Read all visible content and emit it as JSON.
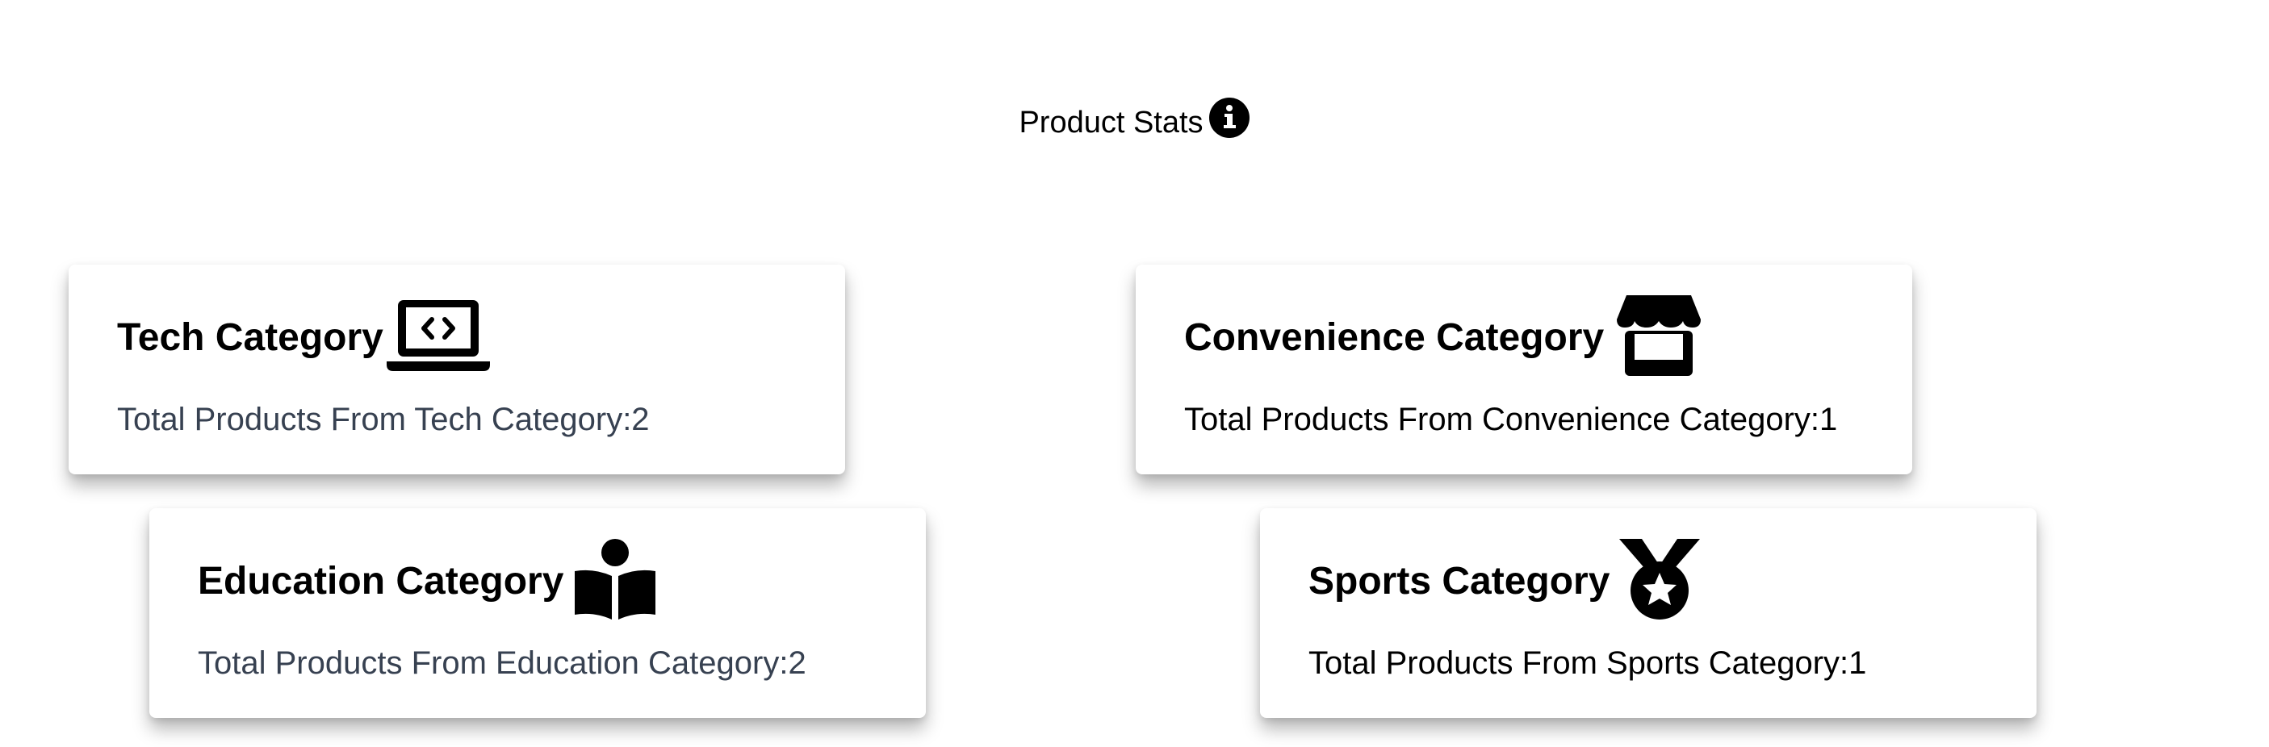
{
  "header": {
    "title": "Product Stats",
    "info_icon": "info-circle-icon"
  },
  "cards": [
    {
      "id": "tech",
      "title": "Tech Category",
      "icon": "laptop-code-icon",
      "description": "Total Products From Tech Category:2",
      "count": 2
    },
    {
      "id": "convenience",
      "title": "Convenience Category",
      "icon": "shop-icon",
      "description": "Total Products From Convenience Category:1",
      "count": 1
    },
    {
      "id": "education",
      "title": "Education Category",
      "icon": "book-reader-icon",
      "description": "Total Products From Education Category:2",
      "count": 2
    },
    {
      "id": "sports",
      "title": "Sports Category",
      "icon": "medal-icon",
      "description": "Total Products From Sports Category:1",
      "count": 1
    }
  ],
  "colors": {
    "text_primary": "#000000",
    "text_secondary": "#374151",
    "background": "#ffffff"
  }
}
